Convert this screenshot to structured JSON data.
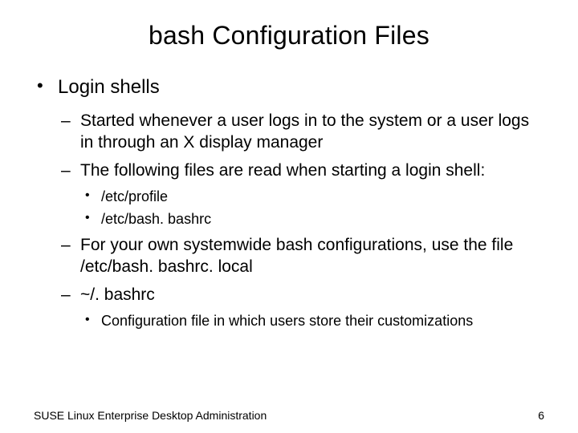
{
  "title": "bash Configuration Files",
  "bullets": {
    "b1": "Login shells",
    "b1_1": "Started whenever a user logs in to the system or a user logs in through an X display manager",
    "b1_2": "The following files are read when starting a login shell:",
    "b1_2_1": "/etc/profile",
    "b1_2_2": "/etc/bash. bashrc",
    "b1_3": "For your own systemwide bash configurations, use the file /etc/bash. bashrc. local",
    "b1_4": "~/. bashrc",
    "b1_4_1": "Configuration file in which users store their customizations"
  },
  "footer_left": "SUSE Linux Enterprise Desktop Administration",
  "footer_right": "6"
}
